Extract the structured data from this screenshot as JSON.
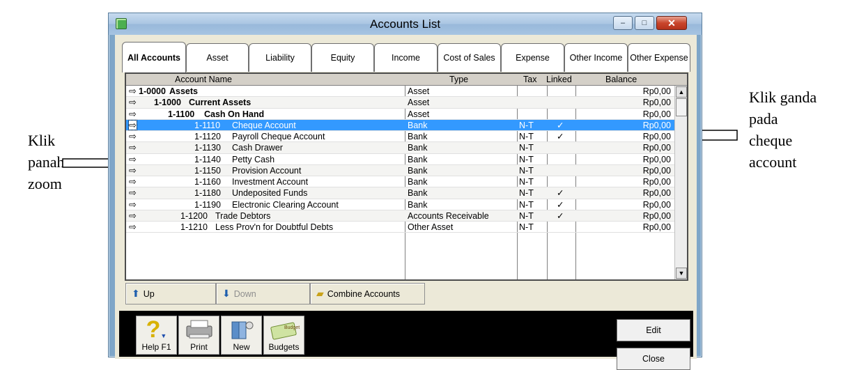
{
  "annotations": {
    "right": [
      "Klik ganda",
      "pada",
      "cheque",
      "account"
    ],
    "left": [
      "Klik",
      "panah",
      "zoom"
    ]
  },
  "window": {
    "title": "Accounts List",
    "controls": {
      "minimize": "–",
      "maximize": "□",
      "close": "✕"
    }
  },
  "tabs": [
    "All Accounts",
    "Asset",
    "Liability",
    "Equity",
    "Income",
    "Cost of Sales",
    "Expense",
    "Other Income",
    "Other Expense"
  ],
  "columns": {
    "name": "Account Name",
    "type": "Type",
    "tax": "Tax",
    "linked": "Linked",
    "balance": "Balance"
  },
  "rows": [
    {
      "num": "1-0000",
      "name": "Assets",
      "type": "Asset",
      "tax": "",
      "linked": "",
      "balance": "Rp0,00"
    },
    {
      "num": "1-1000",
      "name": "Current Assets",
      "type": "Asset",
      "tax": "",
      "linked": "",
      "balance": "Rp0,00"
    },
    {
      "num": "1-1100",
      "name": "Cash On Hand",
      "type": "Asset",
      "tax": "",
      "linked": "",
      "balance": "Rp0,00"
    },
    {
      "num": "1-1110",
      "name": "Cheque Account",
      "type": "Bank",
      "tax": "N-T",
      "linked": "✓",
      "balance": "Rp0,00"
    },
    {
      "num": "1-1120",
      "name": "Payroll Cheque Account",
      "type": "Bank",
      "tax": "N-T",
      "linked": "✓",
      "balance": "Rp0,00"
    },
    {
      "num": "1-1130",
      "name": "Cash Drawer",
      "type": "Bank",
      "tax": "N-T",
      "linked": "",
      "balance": "Rp0,00"
    },
    {
      "num": "1-1140",
      "name": "Petty Cash",
      "type": "Bank",
      "tax": "N-T",
      "linked": "",
      "balance": "Rp0,00"
    },
    {
      "num": "1-1150",
      "name": "Provision Account",
      "type": "Bank",
      "tax": "N-T",
      "linked": "",
      "balance": "Rp0,00"
    },
    {
      "num": "1-1160",
      "name": "Investment Account",
      "type": "Bank",
      "tax": "N-T",
      "linked": "",
      "balance": "Rp0,00"
    },
    {
      "num": "1-1180",
      "name": "Undeposited Funds",
      "type": "Bank",
      "tax": "N-T",
      "linked": "✓",
      "balance": "Rp0,00"
    },
    {
      "num": "1-1190",
      "name": "Electronic Clearing Account",
      "type": "Bank",
      "tax": "N-T",
      "linked": "✓",
      "balance": "Rp0,00"
    },
    {
      "num": "1-1200",
      "name": "Trade Debtors",
      "type": "Accounts Receivable",
      "tax": "N-T",
      "linked": "✓",
      "balance": "Rp0,00"
    },
    {
      "num": "1-1210",
      "name": "Less Prov'n for Doubtful Debts",
      "type": "Other Asset",
      "tax": "N-T",
      "linked": "",
      "balance": "Rp0,00"
    }
  ],
  "buttons": {
    "up": "Up",
    "down": "Down",
    "combine": "Combine Accounts",
    "edit": "Edit",
    "close": "Close"
  },
  "toolbar": {
    "help": "Help F1",
    "print": "Print",
    "new": "New",
    "budgets": "Budgets",
    "budget_sticker": "Budget"
  }
}
